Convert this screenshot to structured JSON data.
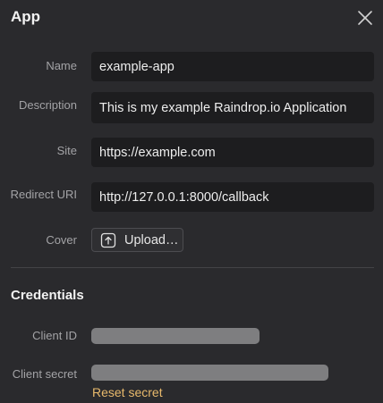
{
  "header": {
    "title": "App"
  },
  "form": {
    "name": {
      "label": "Name",
      "value": "example-app"
    },
    "description": {
      "label": "Description",
      "value": "This is my example Raindrop.io Application"
    },
    "site": {
      "label": "Site",
      "value": "https://example.com"
    },
    "redirect_uri": {
      "label": "Redirect URI",
      "value": "http://127.0.0.1:8000/callback"
    },
    "cover": {
      "label": "Cover",
      "button_label": "Upload…",
      "icon": "upload-icon"
    }
  },
  "credentials": {
    "title": "Credentials",
    "client_id": {
      "label": "Client ID"
    },
    "client_secret": {
      "label": "Client secret",
      "reset_label": "Reset secret"
    }
  },
  "colors": {
    "background": "#2a2a2d",
    "field_background": "#1d1d1f",
    "link": "#e8b96c",
    "masked": "#7e7e80"
  }
}
